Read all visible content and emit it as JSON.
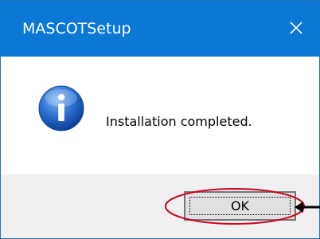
{
  "window": {
    "title": "MASCOTSetup",
    "close_icon": "close-icon"
  },
  "message": {
    "icon": "info-icon",
    "text": "Installation completed."
  },
  "buttons": {
    "ok_label": "OK"
  },
  "annotation": {
    "highlight_color": "#d0021b",
    "arrow_color": "#000000"
  },
  "colors": {
    "titlebar": "#0a78d4",
    "footer": "#f0f0f0",
    "button_face": "#e1e1e1"
  }
}
